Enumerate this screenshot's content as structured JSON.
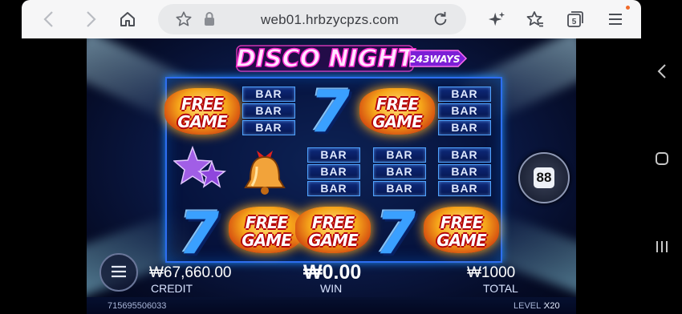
{
  "browser": {
    "url": "web01.hrbzycpzs.com",
    "tab_count": "5",
    "icons": [
      "back-arrow-icon",
      "forward-arrow-icon",
      "home-icon",
      "star-icon",
      "lock-icon",
      "reload-icon",
      "sparkle-icon",
      "bookmarks-icon",
      "tabs-icon",
      "menu-icon"
    ]
  },
  "android_nav": {
    "icons": [
      "back-icon",
      "home-square-icon",
      "recents-icon"
    ]
  },
  "game": {
    "title": "DISCO NIGHT",
    "ways": "243WAYS",
    "symbols": {
      "free_line1": "FREE",
      "free_line2": "GAME",
      "bar": "BAR",
      "seven": "7"
    },
    "autoplay_count": "88",
    "credit_value": "₩67,660.00",
    "credit_label": "CREDIT",
    "win_value": "₩0.00",
    "win_label": "WIN",
    "total_value": "₩1000",
    "total_label": "TOTAL",
    "session_id": "715695506033",
    "level_label": "LEVEL :",
    "level_value": "X20"
  }
}
